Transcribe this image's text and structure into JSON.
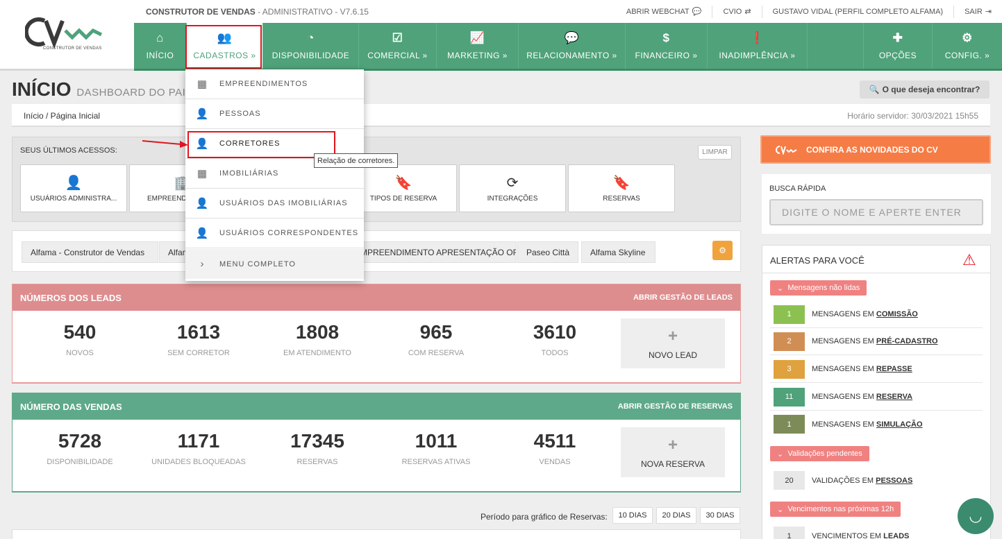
{
  "header": {
    "logo_text": "CONSTRUTOR DE VENDAS",
    "app_name": "CONSTRUTOR DE VENDAS",
    "app_suffix": " - ADMINISTRATIVO - V7.6.15",
    "links": [
      {
        "label": "ABRIR WEBCHAT",
        "icon": "chat-icon"
      },
      {
        "label": "CVIO",
        "icon": "swap-icon"
      },
      {
        "label": "GUSTAVO VIDAL (PERFIL COMPLETO ALFAMA)",
        "icon": ""
      },
      {
        "label": "SAIR",
        "icon": "logout-icon"
      }
    ]
  },
  "nav": {
    "items": [
      {
        "label": "INÍCIO",
        "icon": "home-icon"
      },
      {
        "label": "CADASTROS",
        "icon": "users-icon"
      },
      {
        "label": "DISPONIBILIDADE",
        "icon": "dashboard-icon"
      },
      {
        "label": "COMERCIAL",
        "icon": "check-square-icon"
      },
      {
        "label": "MARKETING",
        "icon": "chart-line-icon"
      },
      {
        "label": "RELACIONAMENTO",
        "icon": "comments-icon"
      },
      {
        "label": "FINANCEIRO",
        "icon": "dollar-icon"
      },
      {
        "label": "INADIMPLÊNCIA",
        "icon": "alert-circle-icon"
      },
      {
        "label": "OPÇÕES",
        "icon": "plus-icon"
      },
      {
        "label": "CONFIG.",
        "icon": "gear-icon"
      }
    ]
  },
  "dropdown": {
    "items": [
      {
        "label": "EMPREENDIMENTOS",
        "icon": "building-icon"
      },
      {
        "label": "PESSOAS",
        "icon": "user-icon"
      },
      {
        "label": "CORRETORES",
        "icon": "user-icon"
      },
      {
        "label": "IMOBILIÁRIAS",
        "icon": "building-icon"
      },
      {
        "label": "USUÁRIOS DAS IMOBILIÁRIAS",
        "icon": "user-icon"
      },
      {
        "label": "USUÁRIOS CORRESPONDENTES",
        "icon": "user-icon"
      },
      {
        "label": "MENU COMPLETO",
        "icon": "chevron-right-icon"
      }
    ],
    "tooltip": "Relação de corretores."
  },
  "page": {
    "title": "INÍCIO",
    "subtitle": "DASHBOARD DO PAINEL",
    "search_label": "O que deseja encontrar?",
    "breadcrumb": "Início  /  Página Inicial",
    "server_time": "Horário servidor: 30/03/2021 15h55"
  },
  "recent": {
    "title": "SEUS ÚLTIMOS ACESSOS:",
    "clear": "LIMPAR",
    "tiles": [
      {
        "label": "USUÁRIOS ADMINISTRA...",
        "icon": "user-icon"
      },
      {
        "label": "EMPREENDIMENTOS",
        "icon": "building-icon"
      },
      {
        "label": "TIPOS DE RESERVA",
        "icon": "bookmark-icon"
      },
      {
        "label": "INTEGRAÇÕES",
        "icon": "refresh-icon"
      },
      {
        "label": "RESERVAS",
        "icon": "bookmark-icon"
      }
    ]
  },
  "projects": [
    "Alfama - Construtor de Vendas",
    "Alfama",
    "EMPREENDIMENTO APRESENTAÇÃO OFICIAL",
    "Paseo Città",
    "Alfama Skyline"
  ],
  "leads": {
    "title": "NÚMEROS DOS LEADS",
    "link": "ABRIR GESTÃO DE LEADS",
    "stats": [
      {
        "value": "540",
        "label": "NOVOS"
      },
      {
        "value": "1613",
        "label": "SEM CORRETOR"
      },
      {
        "value": "1808",
        "label": "EM ATENDIMENTO"
      },
      {
        "value": "965",
        "label": "COM RESERVA"
      },
      {
        "value": "3610",
        "label": "TODOS"
      }
    ],
    "new_label": "NOVO LEAD"
  },
  "vendas": {
    "title": "NÚMERO DAS VENDAS",
    "link": "ABRIR GESTÃO DE RESERVAS",
    "stats": [
      {
        "value": "5728",
        "label": "DISPONIBILIDADE"
      },
      {
        "value": "1171",
        "label": "UNIDADES BLOQUEADAS"
      },
      {
        "value": "17345",
        "label": "RESERVAS"
      },
      {
        "value": "1011",
        "label": "RESERVAS ATIVAS"
      },
      {
        "value": "4511",
        "label": "VENDAS"
      }
    ],
    "new_label": "NOVA RESERVA"
  },
  "period": {
    "label": "Período para gráfico de Reservas:",
    "options": [
      "10 DIAS",
      "20 DIAS",
      "30 DIAS"
    ]
  },
  "right": {
    "novidades": "CONFIRA AS NOVIDADES DO CV",
    "busca_label": "BUSCA RÁPIDA",
    "busca_placeholder": "DIGITE O NOME E APERTE ENTER",
    "alertas_title": "ALERTAS PARA VOCÊ",
    "tag_unread": "Mensagens não lidas",
    "tag_validations": "Validações pendentes",
    "tag_due": "Vencimentos nas próximas 12h",
    "rows": [
      {
        "count": "1",
        "prefix": "MENSAGENS EM",
        "target": "COMISSÃO",
        "color": "#8cc152"
      },
      {
        "count": "2",
        "prefix": "MENSAGENS EM",
        "target": "PRÉ-CADASTRO",
        "color": "#d08e55"
      },
      {
        "count": "3",
        "prefix": "MENSAGENS EM",
        "target": "REPASSE",
        "color": "#e0a23e"
      },
      {
        "count": "11",
        "prefix": "MENSAGENS EM",
        "target": "RESERVA",
        "color": "#4fa27a"
      },
      {
        "count": "1",
        "prefix": "MENSAGENS EM",
        "target": "SIMULAÇÃO",
        "color": "#7d8b58"
      },
      {
        "count": "20",
        "prefix": "VALIDAÇÕES EM",
        "target": "PESSOAS",
        "color": "#e8e8e8"
      },
      {
        "count": "1",
        "prefix": "VENCIMENTOS EM",
        "target": "LEADS",
        "color": "#e8e8e8"
      }
    ]
  }
}
